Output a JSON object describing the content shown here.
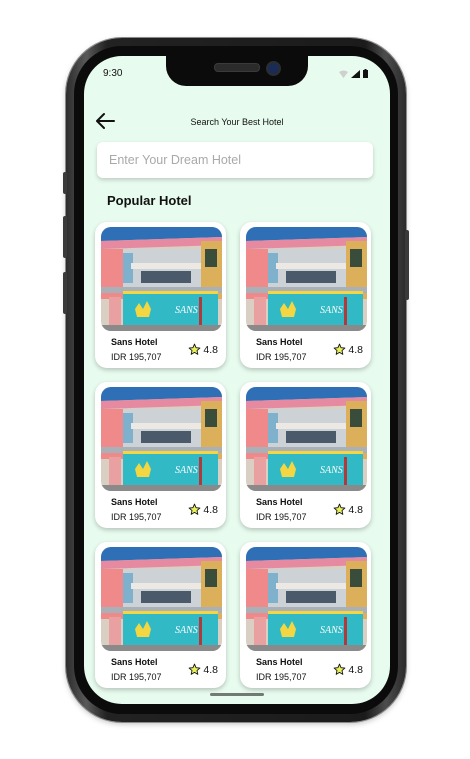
{
  "status_bar": {
    "time": "9:30"
  },
  "header": {
    "title": "Search Your Best Hotel",
    "back_icon": "arrow-left-icon"
  },
  "search": {
    "placeholder": "Enter Your Dream Hotel",
    "value": ""
  },
  "section": {
    "title": "Popular Hotel"
  },
  "hotels": [
    {
      "name": "Sans Hotel",
      "price": "IDR 195,707",
      "rating": "4.8"
    },
    {
      "name": "Sans Hotel",
      "price": "IDR 195,707",
      "rating": "4.8"
    },
    {
      "name": "Sans Hotel",
      "price": "IDR 195,707",
      "rating": "4.8"
    },
    {
      "name": "Sans Hotel",
      "price": "IDR 195,707",
      "rating": "4.8"
    },
    {
      "name": "Sans Hotel",
      "price": "IDR 195,707",
      "rating": "4.8"
    },
    {
      "name": "Sans Hotel",
      "price": "IDR 195,707",
      "rating": "4.8"
    }
  ],
  "photo_sign_text": "SANS",
  "colors": {
    "screen_bg": "#e7fbee",
    "star": "#e8f05a",
    "sign": "#31b9c6"
  }
}
